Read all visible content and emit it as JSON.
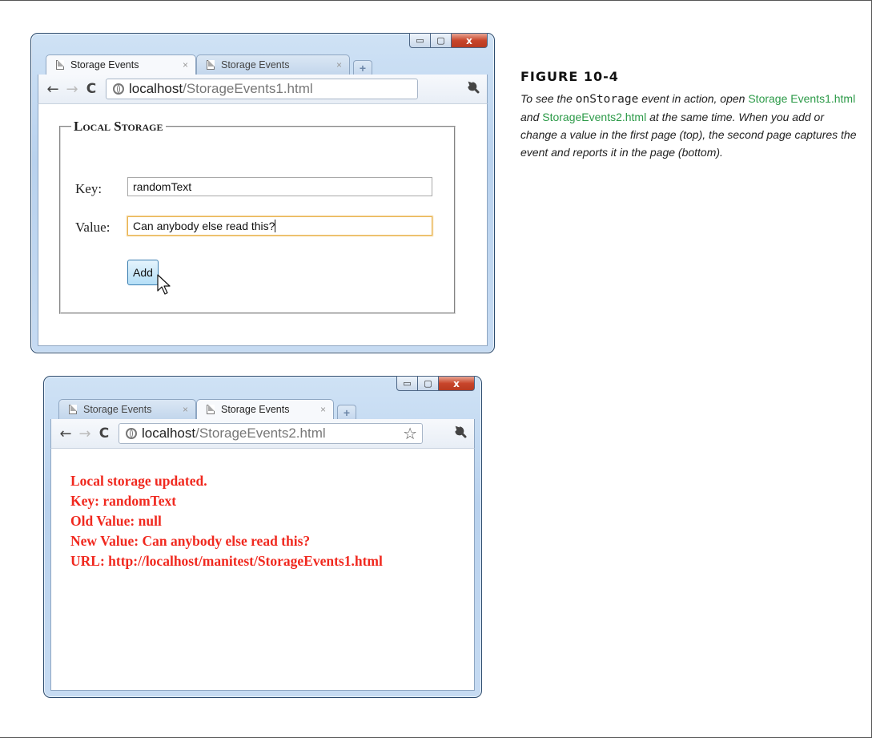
{
  "window1": {
    "tabs": [
      {
        "label": "Storage Events",
        "active": true
      },
      {
        "label": "Storage Events",
        "active": false
      }
    ],
    "tab_close_glyph": "×",
    "new_tab_glyph": "+",
    "url_host": "localhost",
    "url_path": "/StorageEvents1.html",
    "form": {
      "legend": "Local Storage",
      "key_label": "Key:",
      "key_value": "randomText",
      "value_label": "Value:",
      "value_value": "Can anybody else read this?",
      "add_label": "Add"
    }
  },
  "window2": {
    "tabs": [
      {
        "label": "Storage Events",
        "active": false
      },
      {
        "label": "Storage Events",
        "active": true
      }
    ],
    "tab_close_glyph": "×",
    "new_tab_glyph": "+",
    "url_host": "localhost",
    "url_path": "/StorageEvents2.html",
    "report": {
      "line1": "Local storage updated.",
      "line2": "Key: randomText",
      "line3": "Old Value: null",
      "line4": "New Value: Can anybody else read this?",
      "line5": "URL: http://localhost/manitest/StorageEvents1.html"
    }
  },
  "window_controls": {
    "minimize": "▭",
    "maximize": "▢",
    "close": "x"
  },
  "nav_icons": {
    "back": "←",
    "forward": "→",
    "reload": "C",
    "star": "☆",
    "wrench": "wrench-icon"
  },
  "figure": {
    "title": "FIGURE 10-4",
    "caption_part1": "To see the ",
    "caption_code": "onStorage",
    "caption_part2": " event in action, open ",
    "caption_link1": "Storage Events1.html",
    "caption_part3": " and ",
    "caption_link2": "StorageEvents2.html",
    "caption_part4": " at the same time. When you add or change a value in the first page (top), the second page captures the event and reports it in the page (bottom)."
  },
  "colors": {
    "report_text": "#f0281e",
    "link": "#2c9a48",
    "window_frame": "#2d4c6e"
  }
}
